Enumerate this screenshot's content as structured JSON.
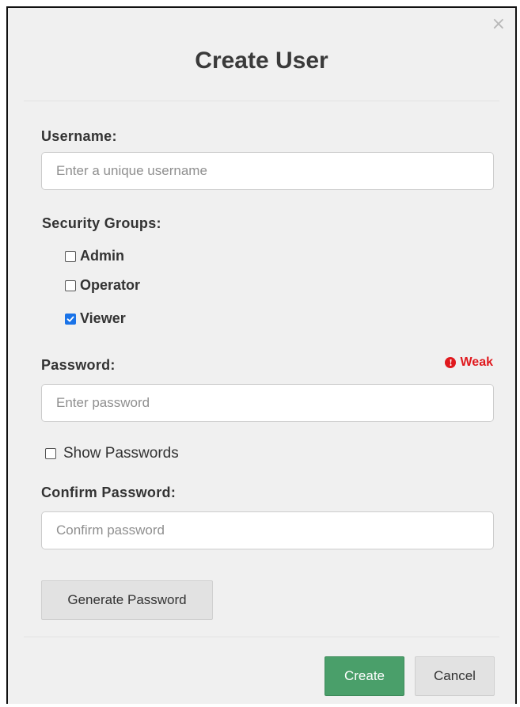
{
  "dialog": {
    "title": "Create User",
    "close_glyph": "×"
  },
  "username": {
    "label": "Username:",
    "placeholder": "Enter a unique username",
    "value": ""
  },
  "security_groups": {
    "label": "Security Groups:",
    "options": [
      {
        "label": "Admin",
        "checked": false
      },
      {
        "label": "Operator",
        "checked": false
      },
      {
        "label": "Viewer",
        "checked": true
      }
    ]
  },
  "password": {
    "label": "Password:",
    "placeholder": "Enter password",
    "value": "",
    "strength_label": "Weak",
    "strength_icon": "exclamation-circle-icon",
    "strength_color": "#e0191e"
  },
  "show_passwords": {
    "label": "Show Passwords",
    "checked": false
  },
  "confirm_password": {
    "label": "Confirm Password:",
    "placeholder": "Confirm password",
    "value": ""
  },
  "buttons": {
    "generate_label": "Generate Password",
    "create_label": "Create",
    "cancel_label": "Cancel",
    "create_color": "#4a9f6a"
  }
}
